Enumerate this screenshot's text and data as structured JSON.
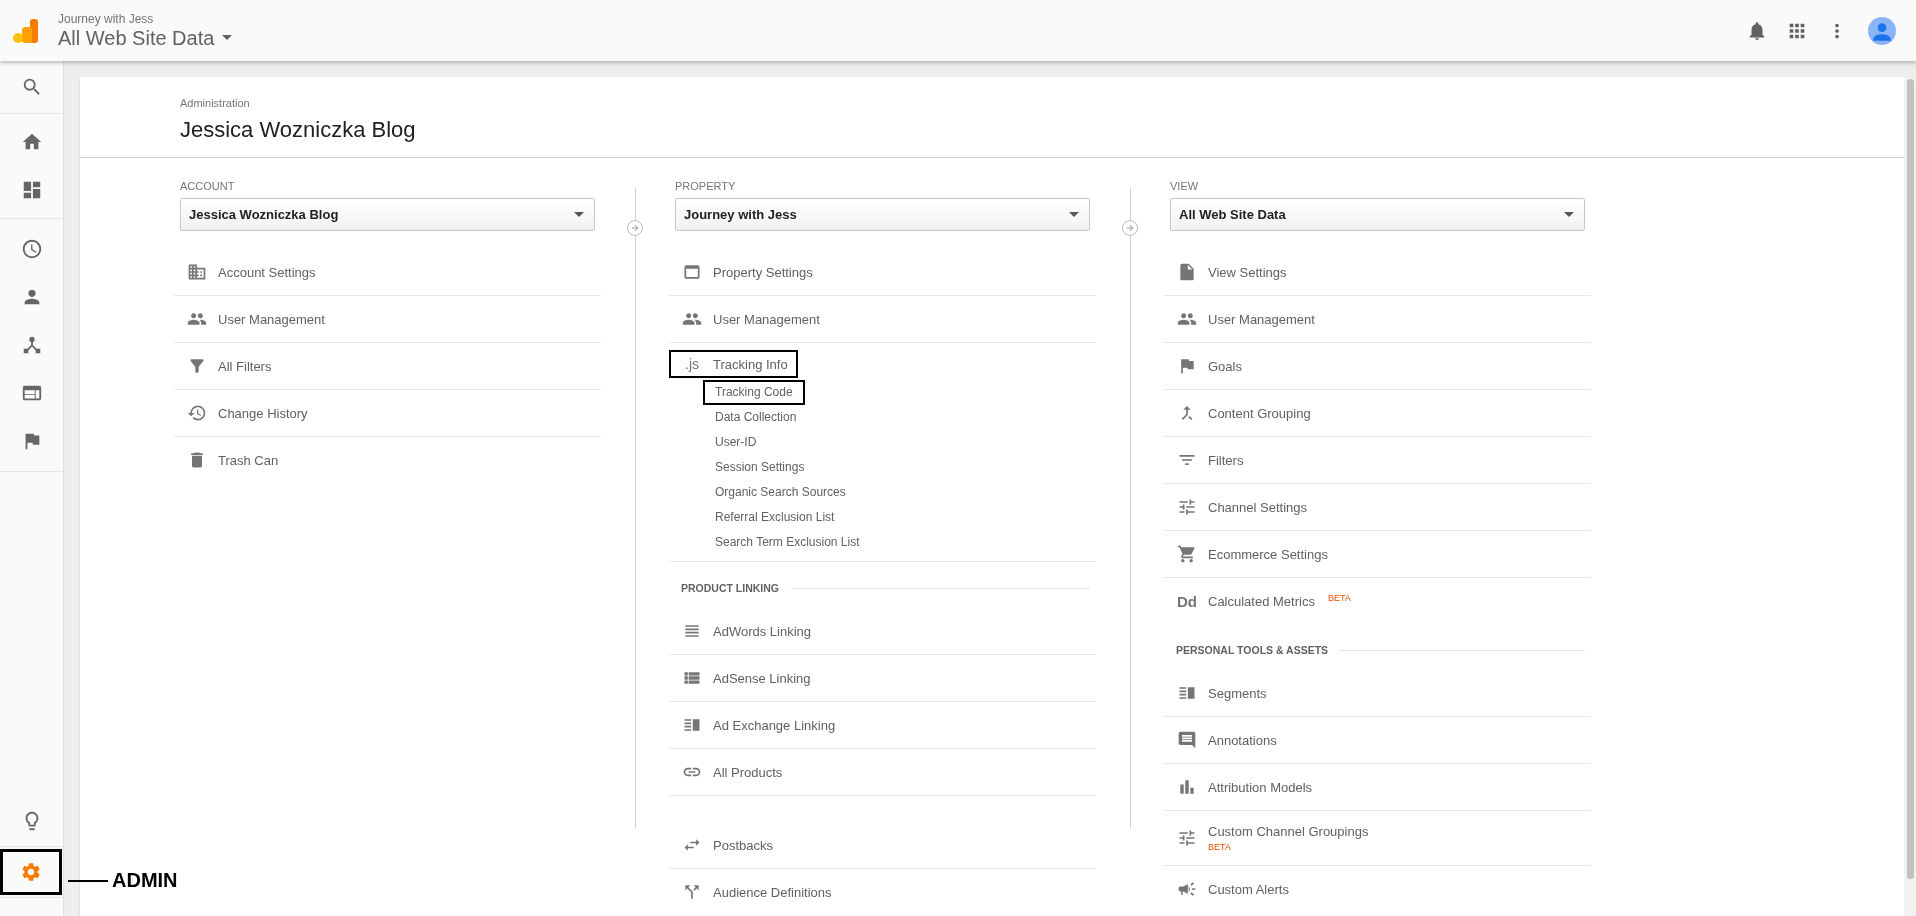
{
  "header": {
    "account": "Journey with Jess",
    "view": "All Web Site Data"
  },
  "nav": {
    "top": [
      [
        {
          "selected": false
        }
      ],
      [
        {
          "selected": false
        },
        {
          "selected": false
        }
      ],
      [
        {
          "selected": false
        },
        {
          "selected": false
        },
        {
          "selected": false
        },
        {
          "selected": false
        },
        {
          "selected": false
        }
      ]
    ],
    "bottom": [
      {
        "selected": false,
        "highlighted": false
      },
      {
        "selected": true,
        "highlighted": true
      }
    ]
  },
  "callout": {
    "label": "ADMIN"
  },
  "admin": {
    "breadcrumb": "Administration",
    "title": "Jessica Wozniczka Blog",
    "columns": [
      {
        "heading": "ACCOUNT",
        "selector": "Jessica Wozniczka Blog",
        "sections": [
          {
            "items": [
              {
                "label": "Account Settings",
                "highlighted": false
              },
              {
                "label": "User Management",
                "highlighted": false
              },
              {
                "label": "All Filters",
                "highlighted": false
              },
              {
                "label": "Change History",
                "highlighted": false
              },
              {
                "label": "Trash Can",
                "highlighted": false
              }
            ]
          }
        ]
      },
      {
        "heading": "PROPERTY",
        "selector": "Journey with Jess",
        "sections": [
          {
            "items": [
              {
                "label": "Property Settings",
                "highlighted": false
              },
              {
                "label": "User Management",
                "highlighted": false
              },
              {
                "label": "Tracking Info",
                "glyph": ".js",
                "highlighted": true,
                "children": [
                  {
                    "label": "Tracking Code",
                    "highlighted": true
                  },
                  {
                    "label": "Data Collection",
                    "highlighted": false
                  },
                  {
                    "label": "User-ID",
                    "highlighted": false
                  },
                  {
                    "label": "Session Settings",
                    "highlighted": false
                  },
                  {
                    "label": "Organic Search Sources",
                    "highlighted": false
                  },
                  {
                    "label": "Referral Exclusion List",
                    "highlighted": false
                  },
                  {
                    "label": "Search Term Exclusion List",
                    "highlighted": false
                  }
                ]
              }
            ]
          },
          {
            "title": "PRODUCT LINKING",
            "items": [
              {
                "label": "AdWords Linking",
                "highlighted": false
              },
              {
                "label": "AdSense Linking",
                "highlighted": false
              },
              {
                "label": "Ad Exchange Linking",
                "highlighted": false
              },
              {
                "label": "All Products",
                "highlighted": false
              }
            ]
          },
          {
            "items": [
              {
                "label": "Postbacks",
                "highlighted": false
              },
              {
                "label": "Audience Definitions",
                "highlighted": false
              }
            ]
          }
        ]
      },
      {
        "heading": "VIEW",
        "selector": "All Web Site Data",
        "sections": [
          {
            "items": [
              {
                "label": "View Settings",
                "highlighted": false
              },
              {
                "label": "User Management",
                "highlighted": false
              },
              {
                "label": "Goals",
                "highlighted": false
              },
              {
                "label": "Content Grouping",
                "highlighted": false
              },
              {
                "label": "Filters",
                "highlighted": false
              },
              {
                "label": "Channel Settings",
                "highlighted": false
              },
              {
                "label": "Ecommerce Settings",
                "highlighted": false
              },
              {
                "label": "Calculated Metrics",
                "glyph": "Dd",
                "badge": "BETA",
                "kind": "inline",
                "highlighted": false
              }
            ]
          },
          {
            "title": "PERSONAL TOOLS & ASSETS",
            "items": [
              {
                "label": "Segments",
                "highlighted": false
              },
              {
                "label": "Annotations",
                "highlighted": false
              },
              {
                "label": "Attribution Models",
                "highlighted": false
              },
              {
                "label": "Custom Channel Groupings",
                "badge": "BETA",
                "kind": "stacked",
                "highlighted": false
              },
              {
                "label": "Custom Alerts",
                "highlighted": false
              }
            ]
          }
        ]
      }
    ]
  }
}
